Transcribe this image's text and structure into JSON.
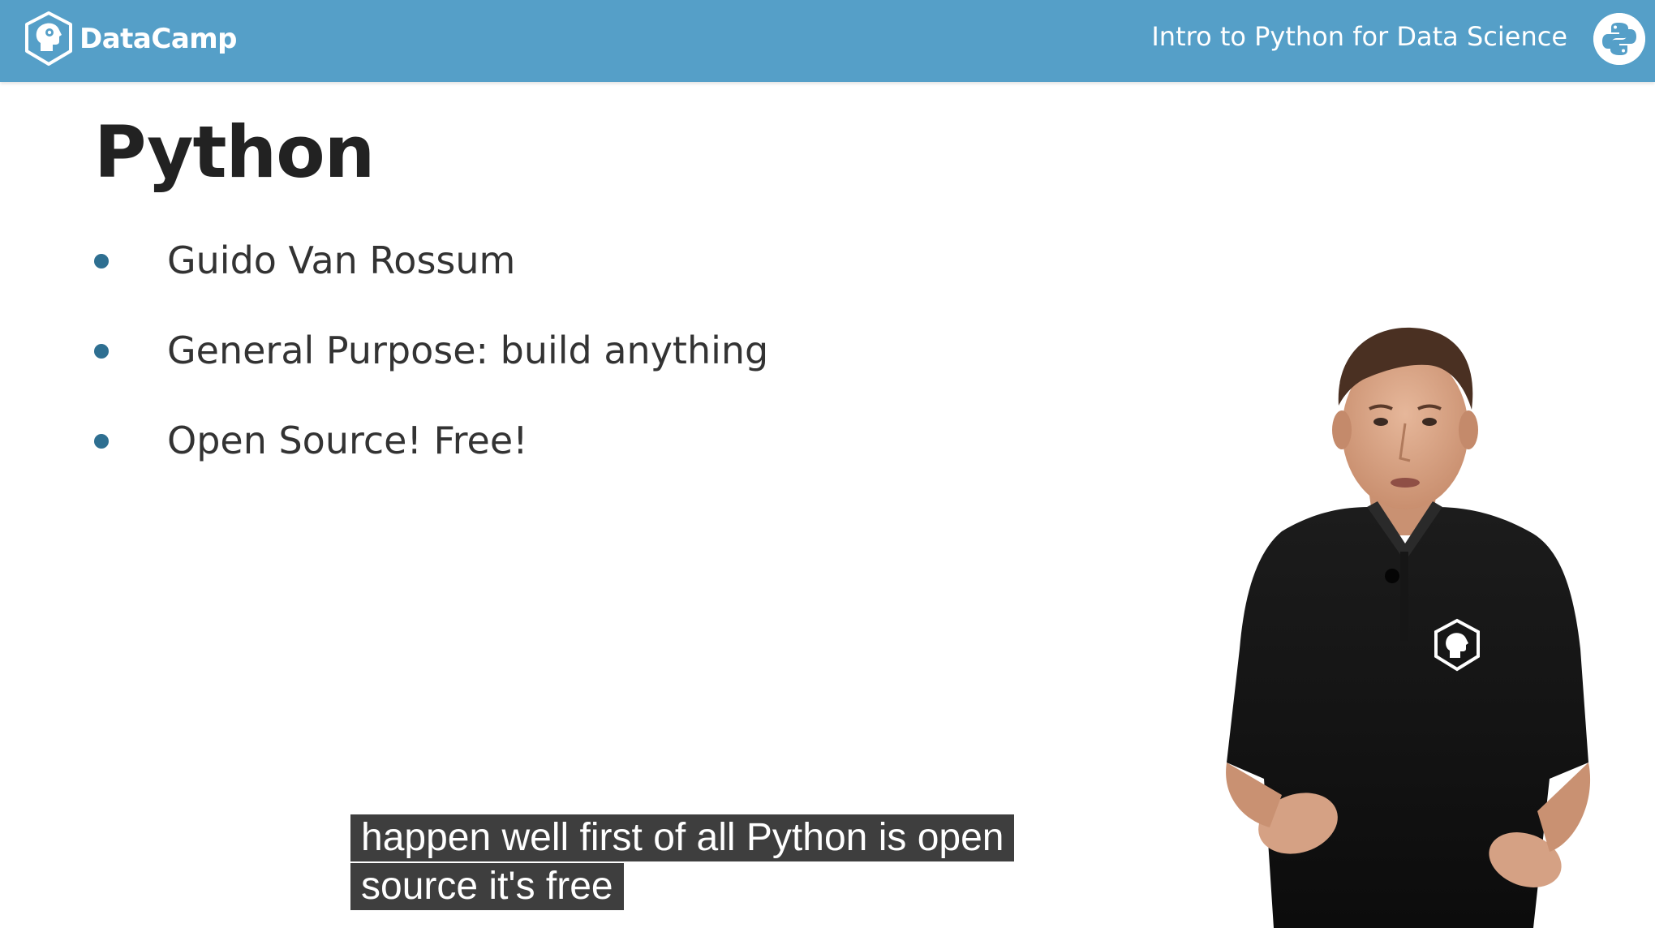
{
  "header": {
    "brand_name": "DataCamp",
    "course_title": "Intro to Python for Data Science",
    "logo_icon": "datacamp-logo-icon",
    "python_icon": "python-logo-icon",
    "background_color": "#559fc8"
  },
  "slide": {
    "title": "Python",
    "bullets": [
      {
        "text": "Guido Van Rossum"
      },
      {
        "text": "General Purpose: build anything"
      },
      {
        "text": "Open Source! Free!"
      }
    ],
    "bullet_color": "#2e6f91"
  },
  "presenter": {
    "icon": "presenter-figure",
    "shirt_logo_icon": "datacamp-logo-icon"
  },
  "captions": {
    "line1": "happen well first of all Python is open",
    "line2": "source it's free"
  }
}
